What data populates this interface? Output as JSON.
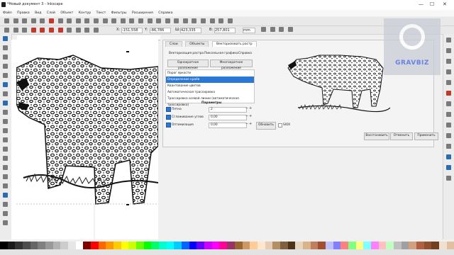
{
  "window": {
    "title": "*Новый документ 3 - Inkscape",
    "minimize": "—",
    "maximize": "☐",
    "close": "✕"
  },
  "menu": [
    "Файл",
    "Правка",
    "Вид",
    "Слой",
    "Объект",
    "Контур",
    "Текст",
    "Фильтры",
    "Расширения",
    "Справка"
  ],
  "toolbar": {
    "x_label": "X:",
    "x_value": "-151,558",
    "y_label": "Y:",
    "y_value": "-86,786",
    "w_label": "Ш:",
    "w_value": "423,335",
    "h_label": "В:",
    "h_value": "257,801",
    "unit": "mm"
  },
  "dialog": {
    "tabs": [
      "Слои",
      "Объекты",
      "Векторизовать растр"
    ],
    "subtabs": [
      "Векторизация растра",
      "Пиксельная графика",
      "Справка"
    ],
    "mode_buttons": [
      "Однократное разложение",
      "Многократное разложение"
    ],
    "methods": [
      "Порог яркости",
      "Определение краёв",
      "Квантование цветов",
      "Автоматическая трассировка",
      "Трассировка осевой линии (автоматическая трассировка)"
    ],
    "selected_method": "Определение краёв",
    "params_title": "Параметры",
    "params": [
      {
        "label": "Пятна",
        "value": "2",
        "checked": true
      },
      {
        "label": "Сглаживание углов",
        "value": "0,00",
        "checked": true
      },
      {
        "label": "Оптимизация",
        "value": "0,00",
        "checked": true
      }
    ],
    "update_button": "Обновить",
    "sioх_label": "SIOX",
    "restore_button": "Восстановить",
    "reset_button": "Отменить",
    "apply_button": "Применить"
  },
  "watermark": {
    "text": "GRAVBIZ",
    "letter": "G"
  },
  "colors": {
    "accent": "#2b78d4",
    "watermark_blue": "#3b5bdb"
  },
  "palette": [
    "#000000",
    "#1a1a1a",
    "#333333",
    "#4d4d4d",
    "#666666",
    "#808080",
    "#999999",
    "#b3b3b3",
    "#cccccc",
    "#e6e6e6",
    "#ffffff",
    "#800000",
    "#ff0000",
    "#ff6600",
    "#ff9900",
    "#ffcc00",
    "#ffff00",
    "#ccff00",
    "#66ff00",
    "#00ff00",
    "#00ff66",
    "#00ffcc",
    "#00ffff",
    "#00ccff",
    "#0066ff",
    "#0000ff",
    "#6600ff",
    "#cc00ff",
    "#ff00ff",
    "#ff0099",
    "#993366",
    "#996633",
    "#cc9966",
    "#ffcc99",
    "#ffe6cc",
    "#e6ccb3",
    "#b38f66",
    "#806040",
    "#4d3319",
    "#e8d5c0",
    "#d9b38c",
    "#c08060",
    "#a05030",
    "#c0c0ff",
    "#8080ff",
    "#ff8080",
    "#80ff80",
    "#ffff80",
    "#80ffff",
    "#ff80ff",
    "#ffc0c0",
    "#c0ffc0",
    "#c0c0c0",
    "#a0a0a0",
    "#d0a080",
    "#b06040",
    "#905030",
    "#704020",
    "#f0e0d0",
    "#e0c0a0"
  ]
}
